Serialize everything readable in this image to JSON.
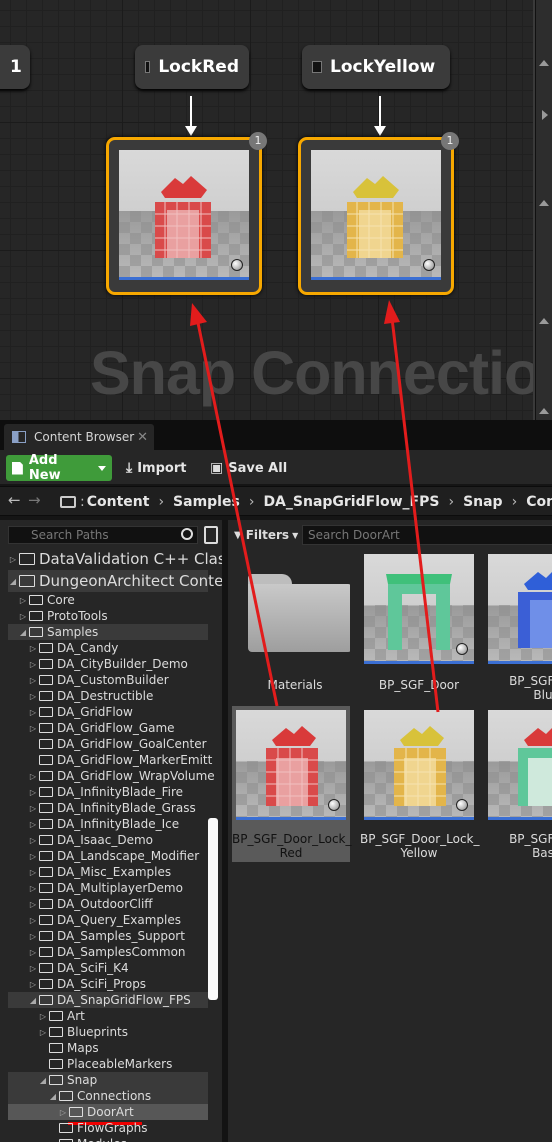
{
  "graph": {
    "partial_node_label": "1",
    "nodes": [
      {
        "label": "LockRed",
        "badge": "1",
        "color": "red"
      },
      {
        "label": "LockYellow",
        "badge": "1",
        "color": "yellow"
      }
    ],
    "watermark": "Snap Connection"
  },
  "content_browser": {
    "tab_title": "Content Browser",
    "tab_close": "✕",
    "toolbar": {
      "add_new": "Add New",
      "import": "Import",
      "save_all": "Save All"
    },
    "path": [
      "Content",
      "Samples",
      "DA_SnapGridFlow_FPS",
      "Snap",
      "Conn"
    ],
    "path_prefix": ":",
    "path_separator": "›",
    "tree": {
      "search_placeholder": "Search Paths",
      "items": [
        {
          "label": "DataValidation C++ Clas",
          "big": true
        },
        {
          "label": "DungeonArchitect Conte",
          "big": true
        },
        {
          "label": "Core"
        },
        {
          "label": "ProtoTools"
        },
        {
          "label": "Samples"
        },
        {
          "label": "DA_Candy"
        },
        {
          "label": "DA_CityBuilder_Demo"
        },
        {
          "label": "DA_CustomBuilder"
        },
        {
          "label": "DA_Destructible"
        },
        {
          "label": "DA_GridFlow"
        },
        {
          "label": "DA_GridFlow_Game"
        },
        {
          "label": "DA_GridFlow_GoalCenter"
        },
        {
          "label": "DA_GridFlow_MarkerEmitt"
        },
        {
          "label": "DA_GridFlow_WrapVolume"
        },
        {
          "label": "DA_InfinityBlade_Fire"
        },
        {
          "label": "DA_InfinityBlade_Grass"
        },
        {
          "label": "DA_InfinityBlade_Ice"
        },
        {
          "label": "DA_Isaac_Demo"
        },
        {
          "label": "DA_Landscape_Modifier"
        },
        {
          "label": "DA_Misc_Examples"
        },
        {
          "label": "DA_MultiplayerDemo"
        },
        {
          "label": "DA_OutdoorCliff"
        },
        {
          "label": "DA_Query_Examples"
        },
        {
          "label": "DA_Samples_Support"
        },
        {
          "label": "DA_SamplesCommon"
        },
        {
          "label": "DA_SciFi_K4"
        },
        {
          "label": "DA_SciFi_Props"
        },
        {
          "label": "DA_SnapGridFlow_FPS"
        },
        {
          "label": "Art"
        },
        {
          "label": "Blueprints"
        },
        {
          "label": "Maps"
        },
        {
          "label": "PlaceableMarkers"
        },
        {
          "label": "Snap"
        },
        {
          "label": "Connections"
        },
        {
          "label": "DoorArt"
        },
        {
          "label": "FlowGraphs"
        },
        {
          "label": "Modules"
        }
      ]
    },
    "filters_label": "Filters",
    "asset_search_value": "Search DoorArt",
    "assets": [
      {
        "name": "Materials",
        "kind": "folder"
      },
      {
        "name": "BP_SGF_Door",
        "kind": "door",
        "color": "#5fc79a"
      },
      {
        "name": "BP_SGF_Door_Lock_Blu",
        "kind": "door",
        "color": "#3b5fd6"
      },
      {
        "name": "BP_SGF_Door_Lock_Red",
        "kind": "door",
        "color": "#d84848"
      },
      {
        "name": "BP_SGF_Door_Lock_Yellow",
        "kind": "door",
        "color": "#e3b54a"
      },
      {
        "name": "BP_SGF_Door_Lock_Bas",
        "kind": "door",
        "color": "#5fc79a"
      }
    ],
    "asset_labels": {
      "a0": "Materials",
      "a1": "BP_SGF_Door",
      "a2l1": "BP_SGF_Do",
      "a2l2": "Blu",
      "a3l1": "BP_SGF_Door_Lock_",
      "a3l2": "Red",
      "a4l1": "BP_SGF_Door_Lock_",
      "a4l2": "Yellow",
      "a5l1": "BP_SGF_Do",
      "a5l2": "Bas"
    }
  },
  "annotation": {
    "arrow_color": "#e21c1c"
  },
  "icons": {
    "add": "doc-plus-icon",
    "import": "import-icon",
    "save": "save-icon",
    "back": "arrow-left-icon",
    "forward": "arrow-right-icon",
    "search": "search-icon",
    "folder": "folder-icon"
  }
}
